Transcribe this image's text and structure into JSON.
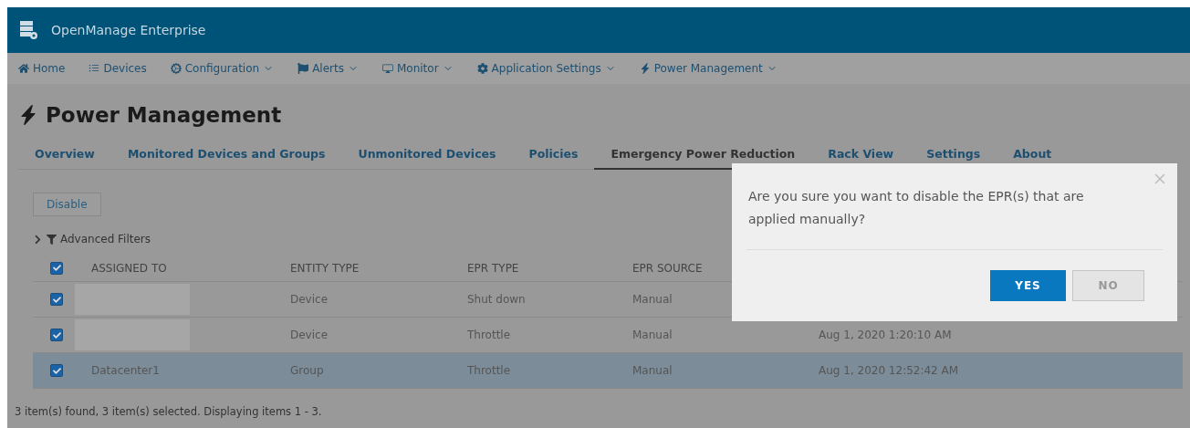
{
  "app": {
    "title": "OpenManage Enterprise"
  },
  "nav": [
    {
      "label": "Home",
      "dropdown": false
    },
    {
      "label": "Devices",
      "dropdown": false
    },
    {
      "label": "Configuration",
      "dropdown": true
    },
    {
      "label": "Alerts",
      "dropdown": true
    },
    {
      "label": "Monitor",
      "dropdown": true
    },
    {
      "label": "Application Settings",
      "dropdown": true
    },
    {
      "label": "Power Management",
      "dropdown": true
    }
  ],
  "page_title": "Power Management",
  "tabs": [
    {
      "label": "Overview",
      "selected": false
    },
    {
      "label": "Monitored Devices and Groups",
      "selected": false
    },
    {
      "label": "Unmonitored Devices",
      "selected": false
    },
    {
      "label": "Policies",
      "selected": false
    },
    {
      "label": "Emergency Power Reduction",
      "selected": true
    },
    {
      "label": "Rack View",
      "selected": false
    },
    {
      "label": "Settings",
      "selected": false
    },
    {
      "label": "About",
      "selected": false
    }
  ],
  "toolbar": {
    "button": "Disable",
    "filters": "Advanced Filters"
  },
  "table": {
    "select_all_checked": true,
    "columns": [
      "ASSIGNED TO",
      "ENTITY TYPE",
      "EPR TYPE",
      "EPR SOURCE"
    ],
    "rows": [
      {
        "checked": true,
        "selected": false,
        "redacted": true,
        "cells": [
          "",
          "Device",
          "Shut down",
          "Manual",
          ""
        ]
      },
      {
        "checked": true,
        "selected": false,
        "redacted": true,
        "cells": [
          "",
          "Device",
          "Throttle",
          "Manual",
          "Aug 1, 2020 1:20:10 AM"
        ]
      },
      {
        "checked": true,
        "selected": true,
        "redacted": false,
        "cells": [
          "Datacenter1",
          "Group",
          "Throttle",
          "Manual",
          "Aug 1, 2020 12:52:42 AM"
        ]
      }
    ]
  },
  "status": "3 item(s) found, 3 item(s) selected. Displaying items 1 - 3.",
  "dialog": {
    "message": "Are you sure you want to disable the EPR(s) that are applied manually?",
    "buttons": [
      {
        "label": "YES",
        "primary": true
      },
      {
        "label": "NO",
        "primary": false
      }
    ]
  }
}
